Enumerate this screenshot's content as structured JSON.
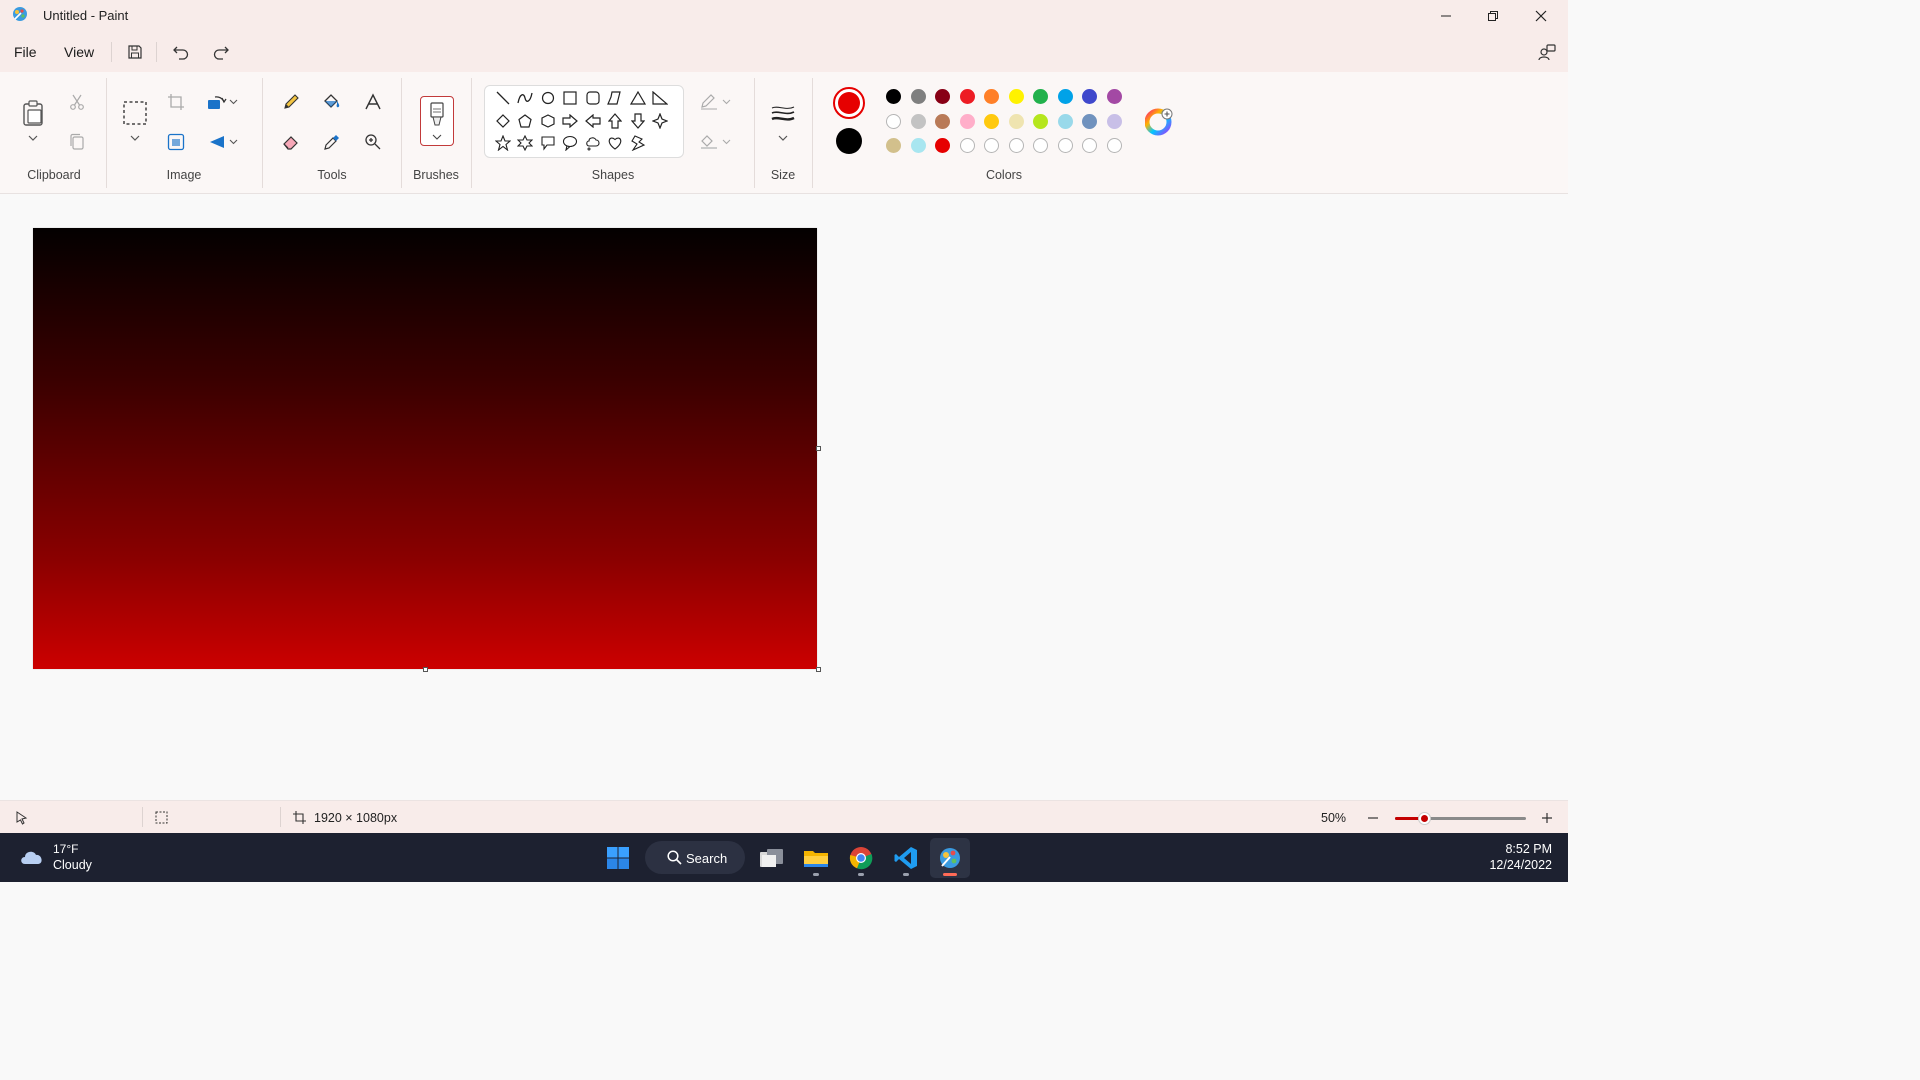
{
  "window": {
    "title": "Untitled - Paint"
  },
  "menu": {
    "file": "File",
    "view": "View"
  },
  "ribbon": {
    "groups": {
      "clipboard": "Clipboard",
      "image": "Image",
      "tools": "Tools",
      "brushes": "Brushes",
      "shapes": "Shapes",
      "size": "Size",
      "colors": "Colors"
    },
    "shapes": [
      "line",
      "curve",
      "oval",
      "rectangle",
      "rounded-rectangle",
      "polygon",
      "triangle",
      "right-triangle",
      "diamond",
      "pentagon",
      "hexagon",
      "right-arrow",
      "left-arrow",
      "up-arrow",
      "down-arrow",
      "four-point-star",
      "five-point-star",
      "six-point-star",
      "rounded-callout",
      "oval-callout",
      "cloud-callout",
      "heart",
      "lightning"
    ],
    "active_colors": {
      "color1": "#e60000",
      "color2": "#000000"
    },
    "palette_row1": [
      "#000000",
      "#7f7f7f",
      "#880015",
      "#ed1c24",
      "#ff7f27",
      "#fff200",
      "#22b14c",
      "#00a2e8",
      "#3f48cc",
      "#a349a4"
    ],
    "palette_row2": [
      "#ffffff",
      "#c3c3c3",
      "#b97a57",
      "#ffaec9",
      "#ffc90e",
      "#efe4b0",
      "#b5e61d",
      "#99d9ea",
      "#7092be",
      "#c8bfe7"
    ],
    "palette_row3": [
      "#d2c08c",
      "#a8e6f0",
      "#e60000",
      "",
      "",
      "",
      "",
      "",
      "",
      ""
    ]
  },
  "canvas": {
    "gradient_top": "#030000",
    "gradient_bottom": "#cc0000"
  },
  "status": {
    "dimensions": "1920 × 1080px",
    "zoom": "50%",
    "zoom_level_fraction": 0.22
  },
  "taskbar": {
    "weather_temp": "17°F",
    "weather_desc": "Cloudy",
    "search": "Search",
    "time": "8:52 PM",
    "date": "12/24/2022"
  }
}
